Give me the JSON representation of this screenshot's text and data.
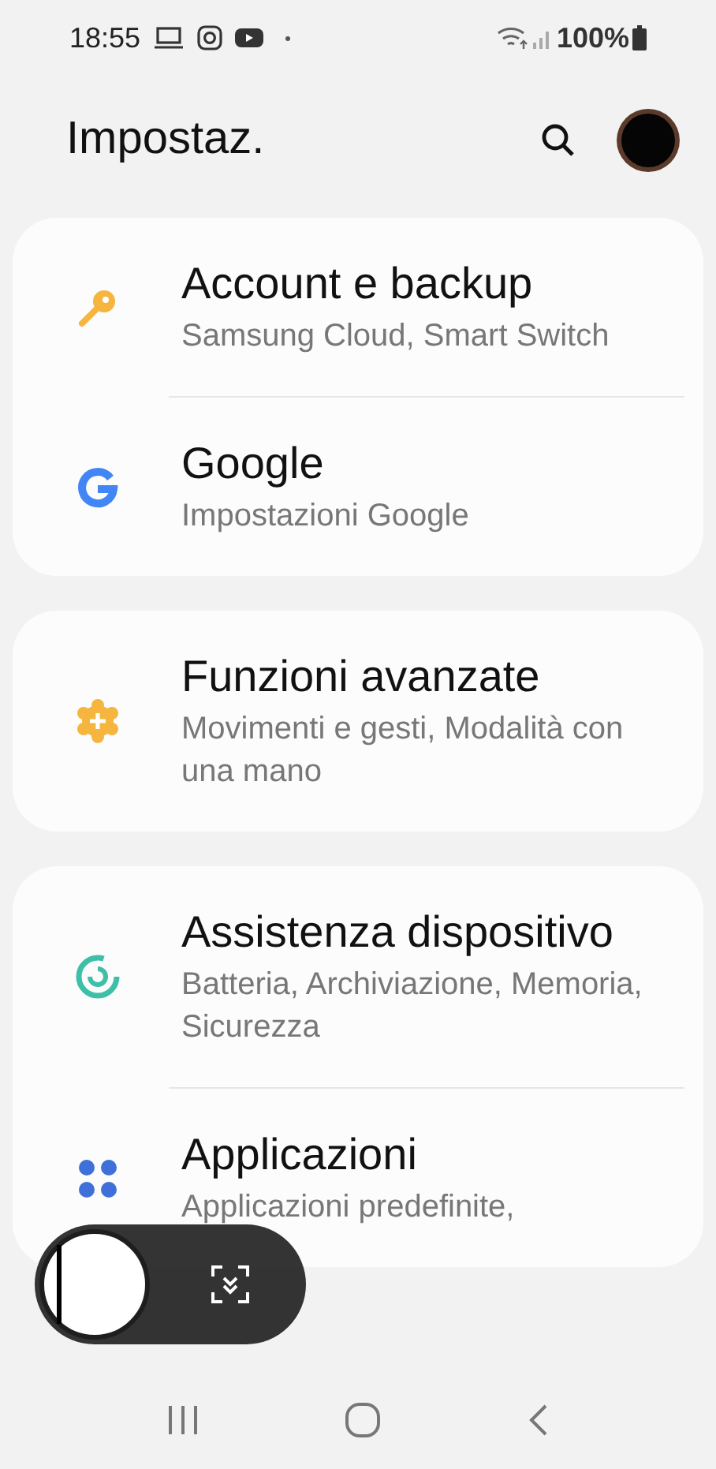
{
  "status_bar": {
    "time": "18:55",
    "battery": "100%"
  },
  "header": {
    "title": "Impostaz."
  },
  "groups": [
    {
      "items": [
        {
          "kind": "key",
          "title": "Account e backup",
          "subtitle": "Samsung Cloud, Smart Switch"
        },
        {
          "kind": "google",
          "title": "Google",
          "subtitle": "Impostazioni Google"
        }
      ]
    },
    {
      "items": [
        {
          "kind": "gear",
          "title": "Funzioni avanzate",
          "subtitle": "Movimenti e gesti, Modalità con una mano"
        }
      ]
    },
    {
      "items": [
        {
          "kind": "care",
          "title": "Assistenza dispositivo",
          "subtitle": "Batteria, Archiviazione, Memoria, Sicurezza"
        },
        {
          "kind": "apps",
          "title": "Applicazioni",
          "subtitle": "Applicazioni predefinite,"
        }
      ]
    }
  ]
}
